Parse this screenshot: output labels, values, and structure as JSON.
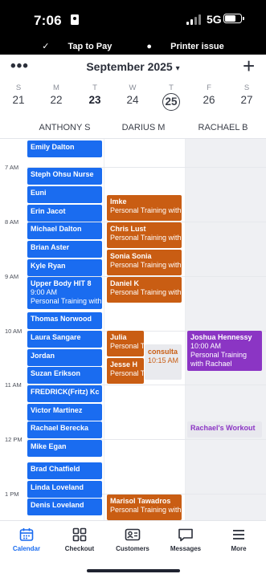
{
  "status_bar": {
    "time": "7:06",
    "network": "5G",
    "notice_1": "Tap to Pay",
    "notice_2": "Printer issue"
  },
  "header": {
    "month": "September 2025",
    "more_icon": "more-dots-icon",
    "add_icon": "plus-icon"
  },
  "week": [
    {
      "letter": "S",
      "date": "21"
    },
    {
      "letter": "M",
      "date": "22"
    },
    {
      "letter": "T",
      "date": "23"
    },
    {
      "letter": "W",
      "date": "24"
    },
    {
      "letter": "T",
      "date": "25"
    },
    {
      "letter": "F",
      "date": "26"
    },
    {
      "letter": "S",
      "date": "27"
    }
  ],
  "staff": [
    "ANTHONY S",
    "DARIUS M",
    "RACHAEL B"
  ],
  "hours": [
    "7 AM",
    "8 AM",
    "9 AM",
    "10 AM",
    "11 AM",
    "12 PM",
    "1 PM"
  ],
  "appointments": {
    "anthony": [
      {
        "name": "Emily  Dalton"
      },
      {
        "name": "Steph Ohsu Nurse"
      },
      {
        "name": "Euni"
      },
      {
        "name": "Erin Jacot"
      },
      {
        "name": "Michael Dalton"
      },
      {
        "name": "Brian Aster"
      },
      {
        "name": "Kyle Ryan"
      },
      {
        "name": "Upper Body HIT 8",
        "time": "9:00 AM",
        "desc": "Personal Training with"
      },
      {
        "name": "Thomas Norwood"
      },
      {
        "name": "Laura Sangare"
      },
      {
        "name": "Jordan"
      },
      {
        "name": "Suzan  Erikson"
      },
      {
        "name": "FREDRICK(Fritz) Kc"
      },
      {
        "name": "Victor  Martinez"
      },
      {
        "name": "Rachael Berecka"
      },
      {
        "name": "Mike Egan"
      },
      {
        "name": "Brad Chatfield"
      },
      {
        "name": "Linda  Loveland"
      },
      {
        "name": "Denis  Loveland"
      }
    ],
    "darius": [
      {
        "name": "Imke",
        "desc": "Personal Training with"
      },
      {
        "name": "Chris Lust",
        "desc": "Personal Training with"
      },
      {
        "name": "Sonia  Sonia",
        "desc": "Personal Training with"
      },
      {
        "name": "Daniel K",
        "desc": "Personal Training with"
      },
      {
        "name": "Julia",
        "desc": "Personal T"
      },
      {
        "name": "Jesse  H",
        "desc": "Personal T"
      },
      {
        "name": "consulta",
        "time": "10:15 AM"
      },
      {
        "name": "Marisol Tawadros",
        "desc": "Personal Training with"
      }
    ],
    "rachael": [
      {
        "name": "Joshua Hennessy",
        "time": "10:00 AM",
        "desc": "Personal Training",
        "desc2": "with Rachael"
      },
      {
        "name": "Rachael's Workout"
      }
    ]
  },
  "nav": [
    {
      "label": "Calendar",
      "icon": "calendar-icon"
    },
    {
      "label": "Checkout",
      "icon": "grid-icon"
    },
    {
      "label": "Customers",
      "icon": "id-card-icon"
    },
    {
      "label": "Messages",
      "icon": "chat-icon"
    },
    {
      "label": "More",
      "icon": "menu-icon"
    }
  ],
  "colors": {
    "blue": "#1a6cf0",
    "orange": "#c95d13",
    "purple": "#8b35c4"
  }
}
